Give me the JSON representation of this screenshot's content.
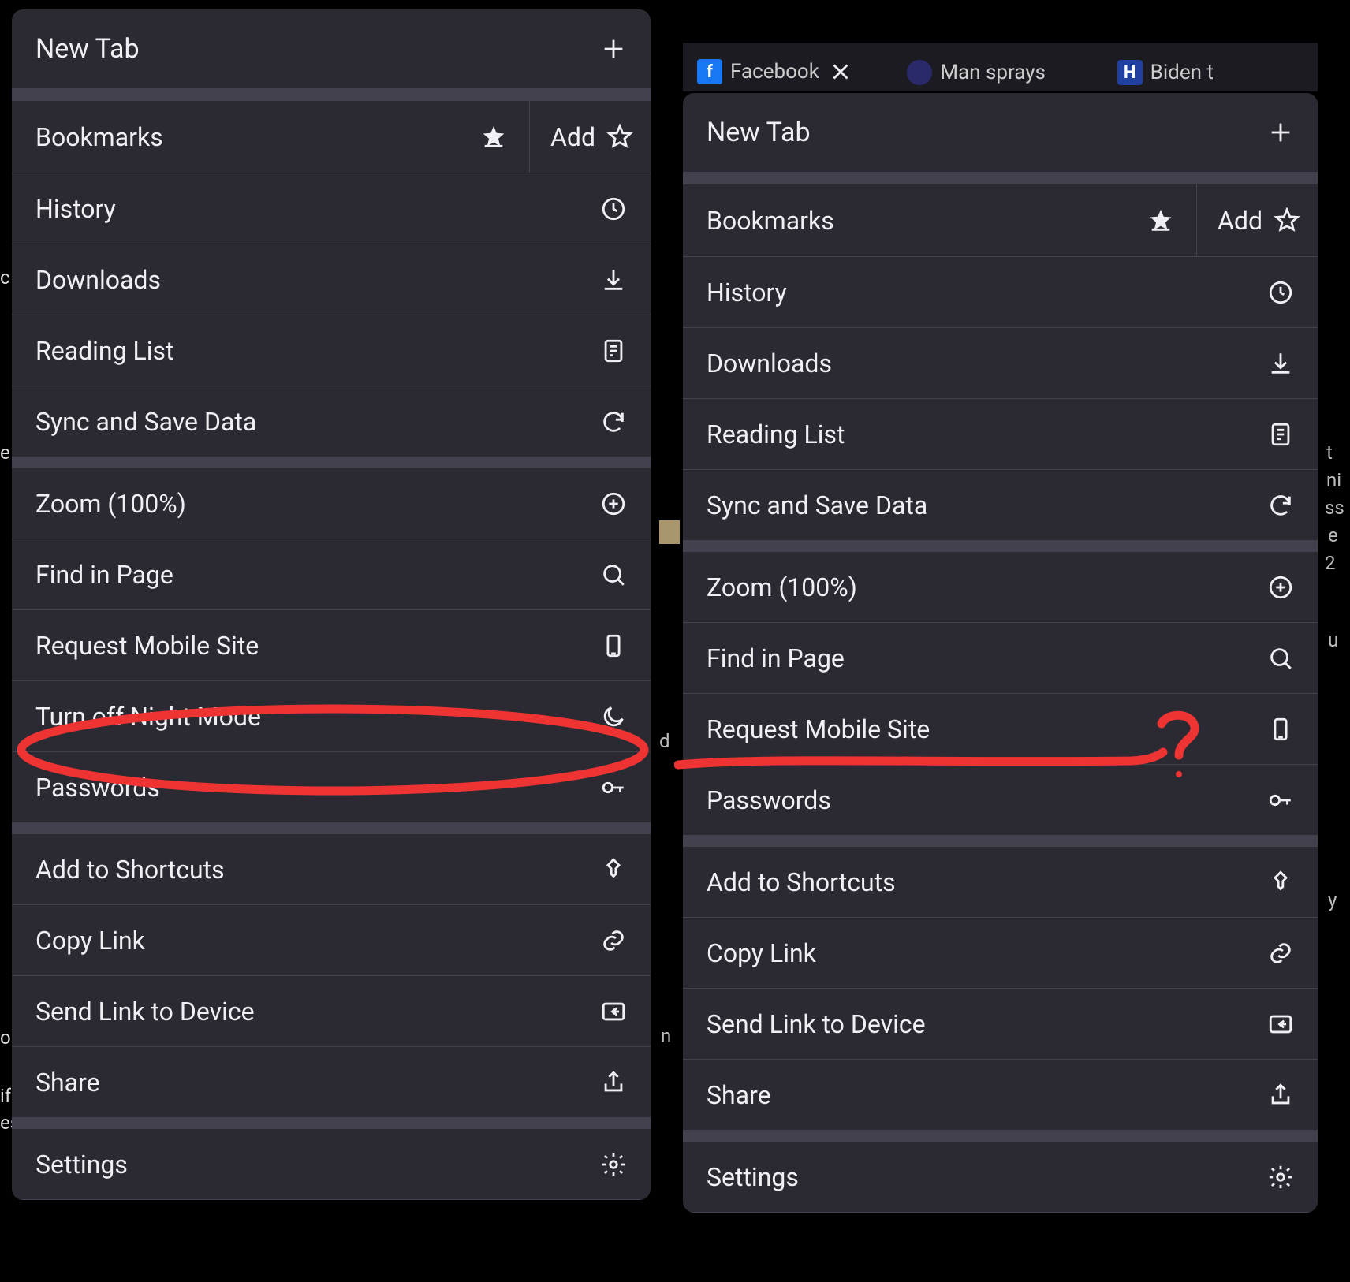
{
  "panels": {
    "left": {
      "header": {
        "label": "New Tab"
      },
      "bookmarks": {
        "label": "Bookmarks",
        "add": "Add"
      },
      "items1": [
        {
          "label": "History",
          "icon": "clock"
        },
        {
          "label": "Downloads",
          "icon": "download"
        },
        {
          "label": "Reading List",
          "icon": "reading"
        },
        {
          "label": "Sync and Save Data",
          "icon": "sync"
        }
      ],
      "items2": [
        {
          "label": "Zoom (100%)",
          "icon": "zoom-plus"
        },
        {
          "label": "Find in Page",
          "icon": "search"
        },
        {
          "label": "Request Mobile Site",
          "icon": "mobile"
        },
        {
          "label": "Turn off Night Mode",
          "icon": "moon"
        },
        {
          "label": "Passwords",
          "icon": "key"
        }
      ],
      "items3": [
        {
          "label": "Add to Shortcuts",
          "icon": "pin"
        },
        {
          "label": "Copy Link",
          "icon": "link"
        },
        {
          "label": "Send Link to Device",
          "icon": "send-device"
        },
        {
          "label": "Share",
          "icon": "share"
        }
      ],
      "items4": [
        {
          "label": "Settings",
          "icon": "gear"
        }
      ]
    },
    "right": {
      "header": {
        "label": "New Tab"
      },
      "bookmarks": {
        "label": "Bookmarks",
        "add": "Add"
      },
      "items1": [
        {
          "label": "History",
          "icon": "clock"
        },
        {
          "label": "Downloads",
          "icon": "download"
        },
        {
          "label": "Reading List",
          "icon": "reading"
        },
        {
          "label": "Sync and Save Data",
          "icon": "sync"
        }
      ],
      "items2": [
        {
          "label": "Zoom (100%)",
          "icon": "zoom-plus"
        },
        {
          "label": "Find in Page",
          "icon": "search"
        },
        {
          "label": "Request Mobile Site",
          "icon": "mobile"
        },
        {
          "label": "Passwords",
          "icon": "key"
        }
      ],
      "items3": [
        {
          "label": "Add to Shortcuts",
          "icon": "pin"
        },
        {
          "label": "Copy Link",
          "icon": "link"
        },
        {
          "label": "Send Link to Device",
          "icon": "send-device"
        },
        {
          "label": "Share",
          "icon": "share"
        }
      ],
      "items4": [
        {
          "label": "Settings",
          "icon": "gear"
        }
      ]
    }
  },
  "tabs": [
    {
      "title": "Facebook",
      "favicon_bg": "#1877f2",
      "favicon_text": "f"
    },
    {
      "title": "Man sprays",
      "favicon_bg": "#2a2a6a",
      "favicon_text": ""
    },
    {
      "title": "Biden t",
      "favicon_bg": "#2040a0",
      "favicon_text": "H"
    }
  ],
  "annotations": {
    "circle_label": "highlight-night-mode",
    "question_label": "missing-night-mode-question"
  }
}
